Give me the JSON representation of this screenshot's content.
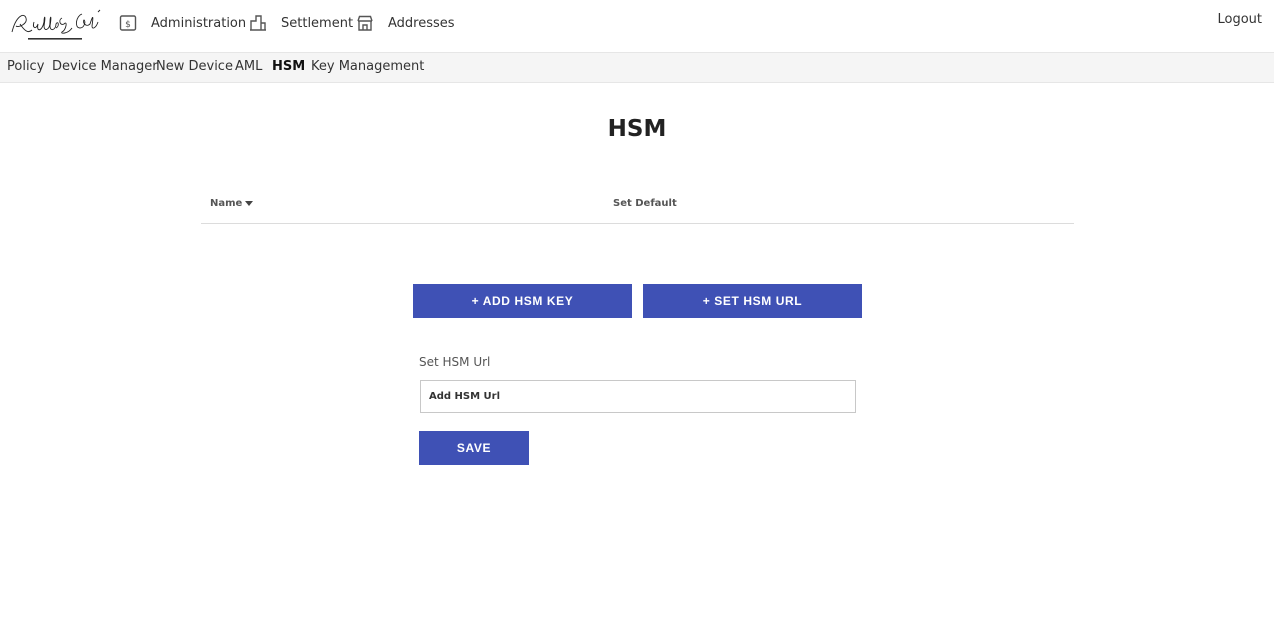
{
  "header": {
    "logo_alt": "Riddle & Code",
    "nav": [
      {
        "label": "Administration",
        "icon": "dollar-box-icon"
      },
      {
        "label": "Settlement",
        "icon": "building-icon"
      },
      {
        "label": "Addresses",
        "icon": "storefront-icon"
      }
    ],
    "logout_label": "Logout"
  },
  "subnav": {
    "items": [
      {
        "label": "Policy",
        "active": false
      },
      {
        "label": "Device Manager",
        "active": false
      },
      {
        "label": "New Device",
        "active": false
      },
      {
        "label": "AML",
        "active": false
      },
      {
        "label": "HSM",
        "active": true
      },
      {
        "label": "Key Management",
        "active": false
      }
    ]
  },
  "page": {
    "title": "HSM",
    "table": {
      "columns": [
        {
          "label": "Name",
          "sorted": "desc"
        },
        {
          "label": "Set Default"
        }
      ]
    },
    "add_key_label": "+ ADD HSM KEY",
    "set_url_label": "+ SET HSM URL",
    "url_field": {
      "label": "Set HSM Url",
      "placeholder": "Add HSM Url"
    },
    "save_label": "SAVE"
  },
  "colors": {
    "primary": "#3f51b5",
    "subnav_bg": "#f5f5f5"
  }
}
